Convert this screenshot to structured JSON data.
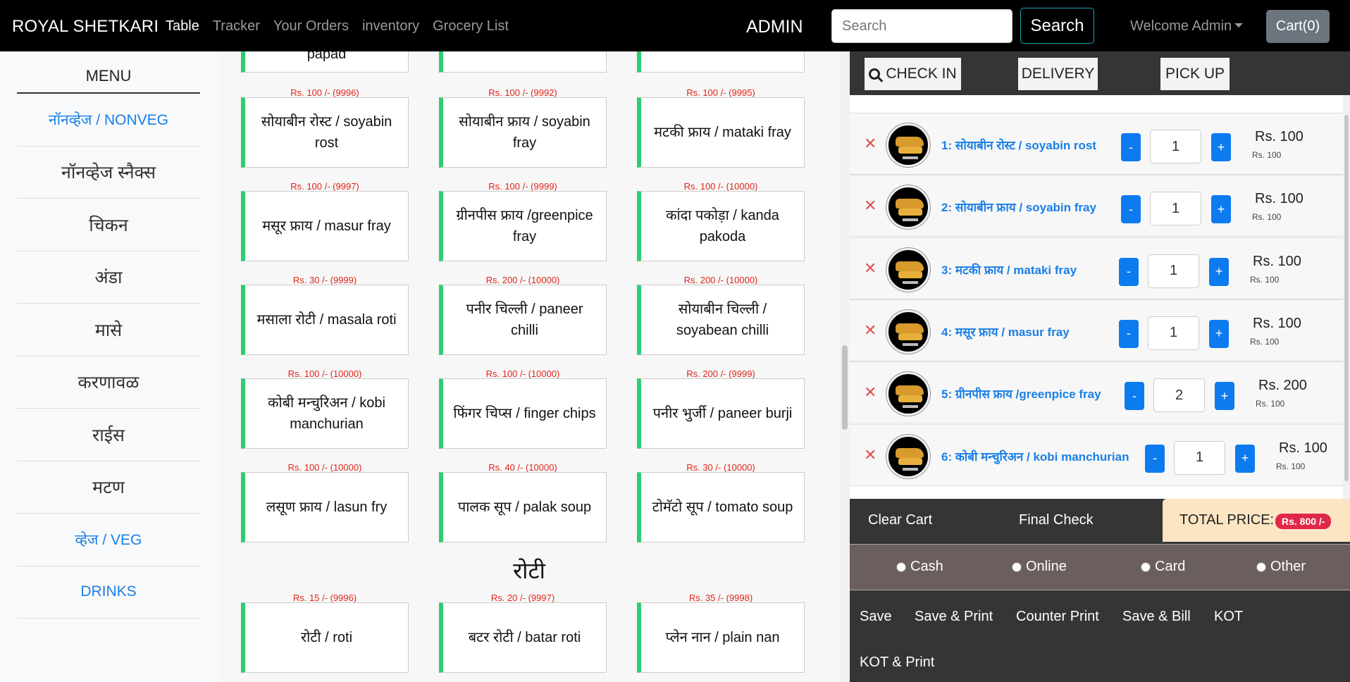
{
  "navbar": {
    "brand": "ROYAL SHETKARI",
    "links": [
      "Table",
      "Tracker",
      "Your Orders",
      "inventory",
      "Grocery List"
    ],
    "admin_label": "ADMIN",
    "search_placeholder": "Search",
    "search_button": "Search",
    "welcome": "Welcome Admin",
    "cart": "Cart(0)"
  },
  "sidebar": {
    "title": "MENU",
    "items": [
      "नॉनव्हेज / NONVEG",
      "नॉनव्हेज स्नैक्स",
      "चिकन",
      "अंडा",
      "मासे",
      "करणावळ",
      "राईस",
      "मटण",
      "व्हेज / VEG",
      "DRINKS"
    ]
  },
  "menu": {
    "top_partial": [
      "papad",
      "",
      ""
    ],
    "cards": [
      {
        "price": "Rs. 100 /- (9996)",
        "name": "सोयाबीन रोस्ट / soyabin rost"
      },
      {
        "price": "Rs. 100 /- (9992)",
        "name": "सोयाबीन फ्राय / soyabin fray"
      },
      {
        "price": "Rs. 100 /- (9995)",
        "name": "मटकी फ्राय / mataki fray"
      },
      {
        "price": "Rs. 100 /- (9997)",
        "name": "मसूर फ्राय / masur fray"
      },
      {
        "price": "Rs. 100 /- (9999)",
        "name": "ग्रीनपीस फ्राय /greenpice fray"
      },
      {
        "price": "Rs. 100 /- (10000)",
        "name": "कांदा पकोड़ा / kanda pakoda"
      },
      {
        "price": "Rs. 30 /- (9999)",
        "name": "मसाला रोटी / masala roti"
      },
      {
        "price": "Rs. 200 /- (10000)",
        "name": "पनीर चिल्ली / paneer chilli"
      },
      {
        "price": "Rs. 200 /- (10000)",
        "name": "सोयाबीन चिल्ली / soyabean chilli"
      },
      {
        "price": "Rs. 100 /- (10000)",
        "name": "कोबी मन्चुरिअन / kobi manchurian"
      },
      {
        "price": "Rs. 100 /- (10000)",
        "name": "फिंगर चिप्स / finger chips"
      },
      {
        "price": "Rs. 200 /- (9999)",
        "name": "पनीर भुर्जी / paneer burji"
      },
      {
        "price": "Rs. 100 /- (10000)",
        "name": "लसूण फ्राय / lasun fry"
      },
      {
        "price": "Rs. 40 /- (10000)",
        "name": "पालक सूप / palak soup"
      },
      {
        "price": "Rs. 30 /- (10000)",
        "name": "टोमॅटो सूप / tomato soup"
      }
    ],
    "section_title": "रोटी",
    "roti_cards": [
      {
        "price": "Rs. 15 /- (9996)",
        "name": "रोटी / roti"
      },
      {
        "price": "Rs. 20 /- (9997)",
        "name": "बटर रोटी / batar roti"
      },
      {
        "price": "Rs. 35 /- (9998)",
        "name": "प्लेन नान / plain nan"
      }
    ]
  },
  "order": {
    "tabs": [
      "CHECK IN",
      "DELIVERY",
      "PICK UP"
    ],
    "items": [
      {
        "name": "1: सोयाबीन रोस्ट / soyabin rost",
        "qty": "1",
        "amount": "Rs. 100",
        "unit": "Rs. 100"
      },
      {
        "name": "2: सोयाबीन फ्राय / soyabin fray",
        "qty": "1",
        "amount": "Rs. 100",
        "unit": "Rs. 100"
      },
      {
        "name": "3: मटकी फ्राय / mataki fray",
        "qty": "1",
        "amount": "Rs. 100",
        "unit": "Rs. 100"
      },
      {
        "name": "4: मसूर फ्राय / masur fray",
        "qty": "1",
        "amount": "Rs. 100",
        "unit": "Rs. 100"
      },
      {
        "name": "5: ग्रीनपीस फ्राय /greenpice fray",
        "qty": "2",
        "amount": "Rs. 200",
        "unit": "Rs. 100"
      },
      {
        "name": "6: कोबी मन्चुरिअन / kobi manchurian",
        "qty": "1",
        "amount": "Rs. 100",
        "unit": "Rs. 100"
      }
    ],
    "remove_symbol": "✕",
    "minus": "-",
    "plus": "+",
    "clear_cart": "Clear Cart",
    "final_check": "Final Check",
    "total_label": "TOTAL PRICE:",
    "total_value": "Rs. 800 /-",
    "payment_options": [
      "Cash",
      "Online",
      "Card",
      "Other"
    ],
    "actions": [
      "Save",
      "Save & Print",
      "Counter Print",
      "Save & Bill",
      "KOT",
      "KOT & Print"
    ]
  },
  "colors": {
    "accent": "#1a7fe6",
    "card_border": "#2ecc71",
    "price": "#e0251b",
    "badge": "#e0284a",
    "qty_button": "#0d7bf0"
  }
}
